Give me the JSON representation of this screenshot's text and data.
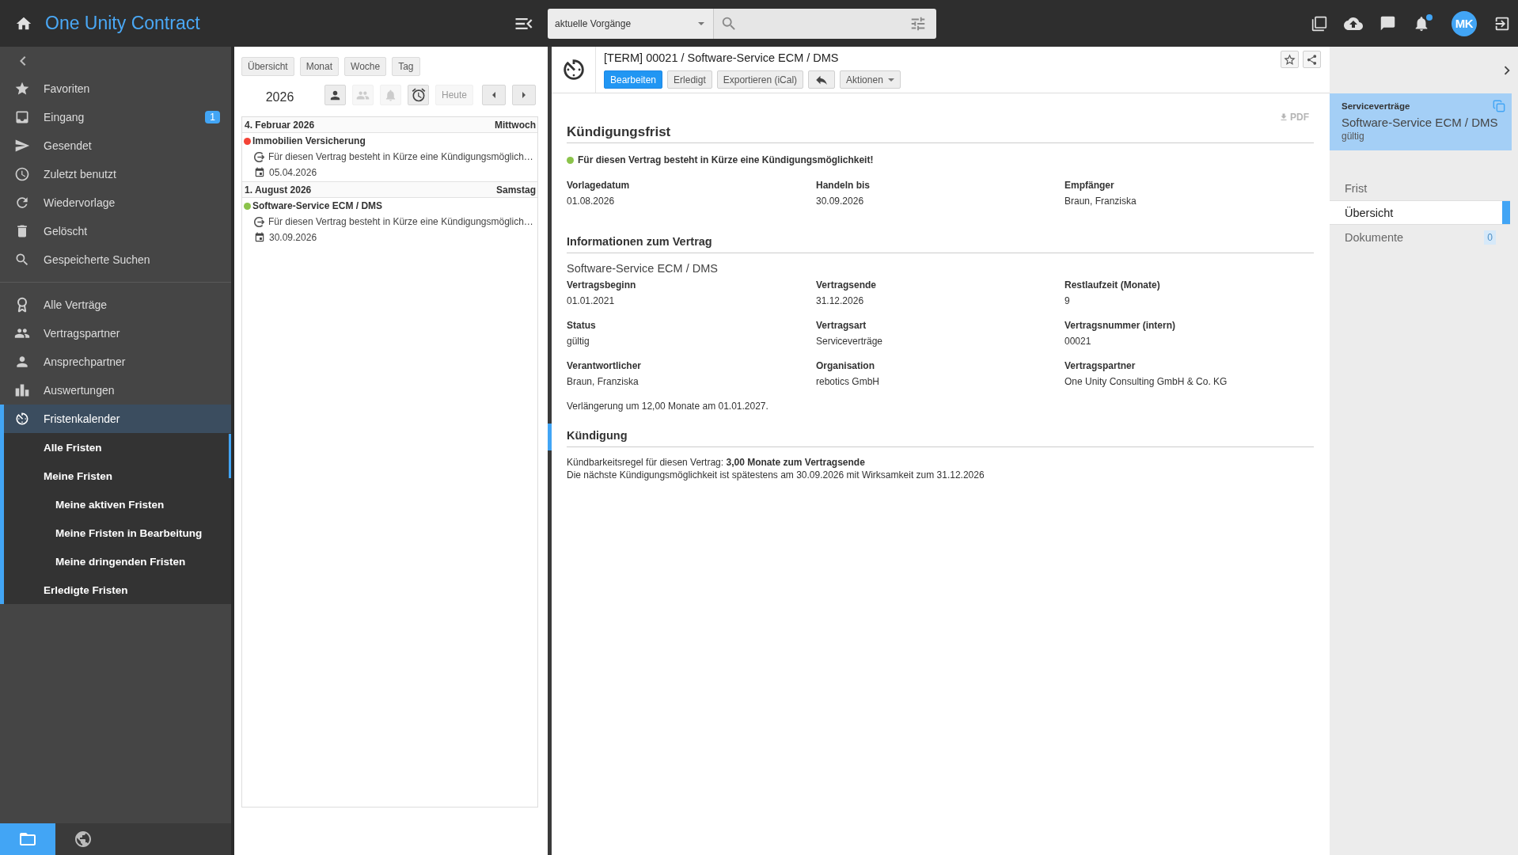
{
  "header": {
    "title": "One Unity Contract",
    "search": {
      "scope": "aktuelle Vorgänge"
    },
    "notifications": {
      "unread": true
    },
    "avatar": "MK"
  },
  "sidebar": {
    "groups": [
      {
        "items": [
          {
            "label": "Favoriten",
            "selected": false
          },
          {
            "label": "Eingang",
            "badge": "1",
            "selected": false
          },
          {
            "label": "Gesendet",
            "selected": false
          },
          {
            "label": "Zuletzt benutzt",
            "selected": false
          },
          {
            "label": "Wiedervorlage",
            "selected": false
          },
          {
            "label": "Gelöscht",
            "selected": false
          },
          {
            "label": "Gespeicherte Suchen",
            "selected": false
          }
        ]
      },
      {
        "items": [
          {
            "label": "Alle Verträge",
            "selected": false
          },
          {
            "label": "Vertragspartner",
            "selected": false
          },
          {
            "label": "Ansprechpartner",
            "selected": false
          },
          {
            "label": "Auswertungen",
            "selected": false
          },
          {
            "label": "Fristenkalender",
            "selected": true,
            "expanded": true,
            "children": [
              {
                "label": "Alle Fristen",
                "selected": false
              },
              {
                "label": "Meine Fristen",
                "selected": false,
                "expanded": true,
                "children": [
                  {
                    "label": "Meine aktiven Fristen",
                    "selected": false
                  },
                  {
                    "label": "Meine Fristen in Bearbeitung",
                    "selected": false
                  },
                  {
                    "label": "Meine dringenden Fristen",
                    "selected": false
                  }
                ]
              },
              {
                "label": "Erledigte Fristen",
                "selected": false
              }
            ]
          }
        ]
      }
    ],
    "footer": [
      {
        "selected": true
      },
      {
        "selected": false
      }
    ]
  },
  "calendar": {
    "views": [
      {
        "label": "Übersicht",
        "selected": false
      },
      {
        "label": "Monat",
        "selected": false
      },
      {
        "label": "Woche",
        "selected": false
      },
      {
        "label": "Tag",
        "selected": false
      }
    ],
    "year": "2026",
    "filters": [
      {
        "disabled": false
      },
      {
        "disabled": true
      },
      {
        "disabled": true
      },
      {
        "disabled": false
      }
    ],
    "today": {
      "label": "Heute",
      "disabled": true
    },
    "days": [
      {
        "date": "4. Februar 2026",
        "weekday": "Mittwoch",
        "entries": [
          {
            "title": "Immobilien Versicherung",
            "color": "#f44336",
            "message": "Für diesen Vertrag besteht in Kürze eine Kündigungsmöglich…",
            "date": "05.04.2026"
          }
        ]
      },
      {
        "date": "1. August 2026",
        "weekday": "Samstag",
        "entries": [
          {
            "title": "Software-Service ECM / DMS",
            "color": "#8bc34a",
            "message": "Für diesen Vertrag besteht in Kürze eine Kündigungsmöglich…",
            "date": "30.09.2026"
          }
        ]
      }
    ]
  },
  "detail": {
    "title": "[TERM] 00021 / Software-Service ECM / DMS",
    "actions": [
      {
        "kind": "primary",
        "label": "Bearbeiten"
      },
      {
        "kind": "default",
        "label": "Erledigt"
      },
      {
        "kind": "default",
        "label": "Exportieren (iCal)"
      },
      {
        "kind": "icon"
      },
      {
        "kind": "dropdown",
        "label": "Aktionen"
      }
    ],
    "favorite": false,
    "pdf": "PDF",
    "heading": "Kündigungsfrist",
    "alert": {
      "text": "Für diesen Vertrag besteht in Kürze eine Kündigungsmöglichkeit!",
      "color": "#8bc34a"
    },
    "summary": [
      {
        "label": "Vorlagedatum",
        "value": "01.08.2026"
      },
      {
        "label": "Handeln bis",
        "value": "30.09.2026"
      },
      {
        "label": "Empfänger",
        "value": "Braun, Franziska"
      }
    ],
    "sections": [
      {
        "title": "Informationen zum Vertrag",
        "subtitle": "Software-Service ECM / DMS",
        "fields": [
          {
            "label": "Vertragsbeginn",
            "value": "01.01.2021"
          },
          {
            "label": "Vertragsende",
            "value": "31.12.2026"
          },
          {
            "label": "Restlaufzeit (Monate)",
            "value": "9"
          },
          {
            "label": "Status",
            "value": "gültig"
          },
          {
            "label": "Vertragsart",
            "value": "Serviceverträge"
          },
          {
            "label": "Vertragsnummer (intern)",
            "value": "00021"
          },
          {
            "label": "Verantwortlicher",
            "value": "Braun, Franziska"
          },
          {
            "label": "Organisation",
            "value": "rebotics GmbH"
          },
          {
            "label": "Vertragspartner",
            "value": "One Unity Consulting GmbH & Co. KG"
          }
        ],
        "note": "Verlängerung um 12,00 Monate am 01.01.2027."
      },
      {
        "title": "Kündigung",
        "lines": [
          "Kündbarkeitsregel für diesen Vertrag: **3,00 Monate zum Vertragsende**",
          "Die nächste Kündigungsmöglichkeit ist spätestens am 30.09.2026 mit Wirksamkeit zum 31.12.2026"
        ]
      }
    ]
  },
  "right_panel": {
    "card": {
      "category": "Serviceverträge",
      "title": "Software-Service ECM / DMS",
      "status": "gültig",
      "selected": true
    },
    "tabs": [
      {
        "label": "Frist",
        "selected": false
      },
      {
        "label": "Übersicht",
        "selected": true
      },
      {
        "label": "Dokumente",
        "count": "0",
        "selected": false
      }
    ]
  }
}
